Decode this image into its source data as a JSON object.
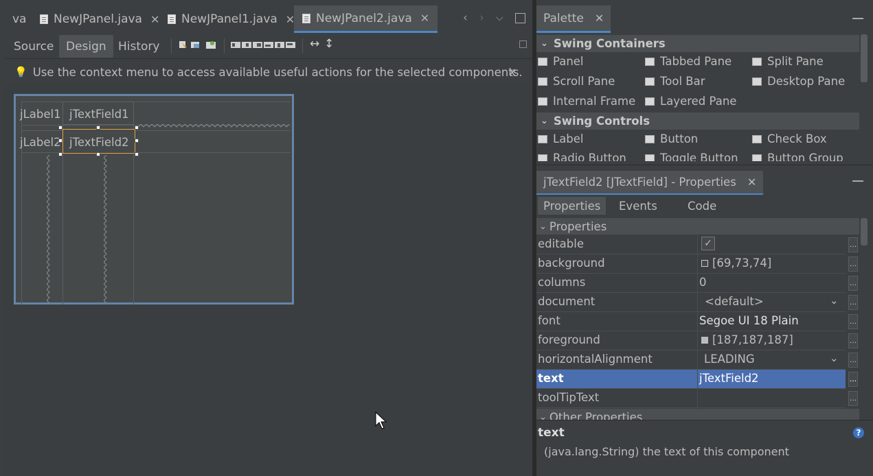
{
  "editor_tabs": [
    {
      "label": "va"
    },
    {
      "label": "NewJPanel.java"
    },
    {
      "label": "NewJPanel1.java"
    },
    {
      "label": "NewJPanel2.java",
      "active": true
    }
  ],
  "editor_view_tabs": {
    "source": "Source",
    "design": "Design",
    "history": "History"
  },
  "hint": {
    "text": "Use the context menu to access available useful actions for the selected components.",
    "close": "x"
  },
  "form": {
    "label1": "jLabel1",
    "label2": "jLabel2",
    "field1": "jTextField1",
    "field2": "jTextField2"
  },
  "palette": {
    "title": "Palette",
    "categories": [
      {
        "name": "Swing Containers",
        "items": [
          "Panel",
          "Tabbed Pane",
          "Split Pane",
          "Scroll Pane",
          "Tool Bar",
          "Desktop Pane",
          "Internal Frame",
          "Layered Pane"
        ]
      },
      {
        "name": "Swing Controls",
        "items": [
          "Label",
          "Button",
          "Check Box",
          "Radio Button",
          "Toggle Button",
          "Button Group"
        ]
      }
    ]
  },
  "properties": {
    "title": "jTextField2 [JTextField] - Properties",
    "tabs": [
      "Properties",
      "Events",
      "Code"
    ],
    "section": "Properties",
    "rows": [
      {
        "name": "editable",
        "value": "✓"
      },
      {
        "name": "background",
        "value": "[69,73,74]"
      },
      {
        "name": "columns",
        "value": "0"
      },
      {
        "name": "document",
        "value": "<default>"
      },
      {
        "name": "font",
        "value": "Segoe UI 18 Plain"
      },
      {
        "name": "foreground",
        "value": "[187,187,187]"
      },
      {
        "name": "horizontalAlignment",
        "value": "LEADING"
      },
      {
        "name": "text",
        "value": "jTextField2"
      },
      {
        "name": "toolTipText",
        "value": ""
      }
    ],
    "other_section": "Other Properties",
    "dots_label": "..."
  },
  "description": {
    "title": "text",
    "body": "(java.lang.String) the text of this component",
    "help": "?"
  },
  "colors": {
    "accent": "#4a88c7",
    "selection": "#4b6eaf",
    "frame": "#6585a8",
    "selected_field": "#e8a33d"
  }
}
